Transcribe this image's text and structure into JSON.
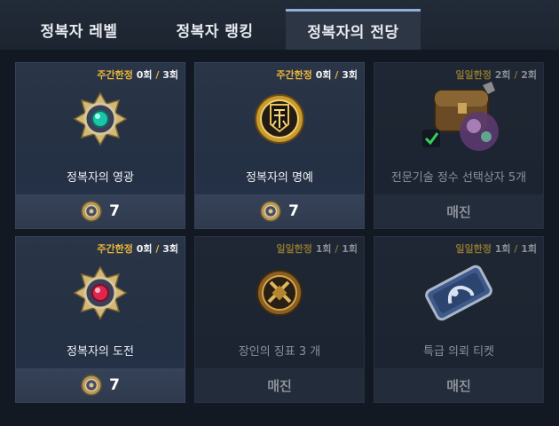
{
  "tabs": [
    {
      "label": "정복자 레벨"
    },
    {
      "label": "정복자 랭킹"
    },
    {
      "label": "정복자의 전당"
    }
  ],
  "items": [
    {
      "limit_label": "주간한정",
      "used": "0회",
      "total": "3회",
      "name": "정복자의 영광",
      "price": "7",
      "sold_label": "",
      "icon": "emerald-medal-icon"
    },
    {
      "limit_label": "주간한정",
      "used": "0회",
      "total": "3회",
      "name": "정복자의 명예",
      "price": "7",
      "sold_label": "",
      "icon": "golden-banner-medal-icon"
    },
    {
      "limit_label": "일일한정",
      "used": "2회",
      "total": "2회",
      "name": "전문기술 정수 선택상자 5개",
      "price": "",
      "sold_label": "매진",
      "icon": "treasure-chest-icon"
    },
    {
      "limit_label": "주간한정",
      "used": "0회",
      "total": "3회",
      "name": "정복자의 도전",
      "price": "7",
      "sold_label": "",
      "icon": "ruby-medal-icon"
    },
    {
      "limit_label": "일일한정",
      "used": "1회",
      "total": "1회",
      "name": "장인의 징표 3 개",
      "price": "",
      "sold_label": "매진",
      "icon": "craftsman-token-icon"
    },
    {
      "limit_label": "일일한정",
      "used": "1회",
      "total": "1회",
      "name": "특급 의뢰 티켓",
      "price": "",
      "sold_label": "매진",
      "icon": "request-ticket-icon"
    }
  ],
  "colors": {
    "limit_gold": "#e8b53a",
    "tab_active": "#2d3645",
    "card_bg": "#2a3547"
  }
}
